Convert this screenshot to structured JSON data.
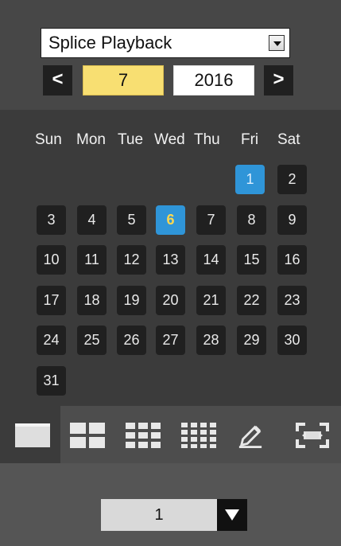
{
  "playback": {
    "mode": "Splice Playback",
    "month": "7",
    "year": "2016",
    "previous_label": "<",
    "next_label": ">"
  },
  "calendar": {
    "weekdays": [
      "Sun",
      "Mon",
      "Tue",
      "Wed",
      "Thu",
      "Fri",
      "Sat"
    ],
    "days": [
      {
        "label": "1",
        "state": "recorded"
      },
      {
        "label": "2",
        "state": "normal"
      },
      {
        "label": "3",
        "state": "normal"
      },
      {
        "label": "4",
        "state": "normal"
      },
      {
        "label": "5",
        "state": "normal"
      },
      {
        "label": "6",
        "state": "selected"
      },
      {
        "label": "7",
        "state": "normal"
      },
      {
        "label": "8",
        "state": "normal"
      },
      {
        "label": "9",
        "state": "normal"
      },
      {
        "label": "10",
        "state": "normal"
      },
      {
        "label": "11",
        "state": "normal"
      },
      {
        "label": "12",
        "state": "normal"
      },
      {
        "label": "13",
        "state": "normal"
      },
      {
        "label": "14",
        "state": "normal"
      },
      {
        "label": "15",
        "state": "normal"
      },
      {
        "label": "16",
        "state": "normal"
      },
      {
        "label": "17",
        "state": "normal"
      },
      {
        "label": "18",
        "state": "normal"
      },
      {
        "label": "19",
        "state": "normal"
      },
      {
        "label": "20",
        "state": "normal"
      },
      {
        "label": "21",
        "state": "normal"
      },
      {
        "label": "22",
        "state": "normal"
      },
      {
        "label": "23",
        "state": "normal"
      },
      {
        "label": "24",
        "state": "normal"
      },
      {
        "label": "25",
        "state": "normal"
      },
      {
        "label": "26",
        "state": "normal"
      },
      {
        "label": "27",
        "state": "normal"
      },
      {
        "label": "28",
        "state": "normal"
      },
      {
        "label": "29",
        "state": "normal"
      },
      {
        "label": "30",
        "state": "normal"
      },
      {
        "label": "31",
        "state": "normal"
      }
    ]
  },
  "toolbar": {
    "icons": [
      "single-view-icon",
      "four-window-icon",
      "nine-window-icon",
      "sixteen-window-icon",
      "edit-icon",
      "fullscreen-icon"
    ]
  },
  "page": {
    "value": "1"
  },
  "colors": {
    "panel_dark": "#3b3b3b",
    "panel_header": "#474747",
    "day_tile": "#202020",
    "recorded_day": "#2f95d8",
    "selected_day_text": "#ffd84e",
    "month_highlight": "#f8df72"
  }
}
